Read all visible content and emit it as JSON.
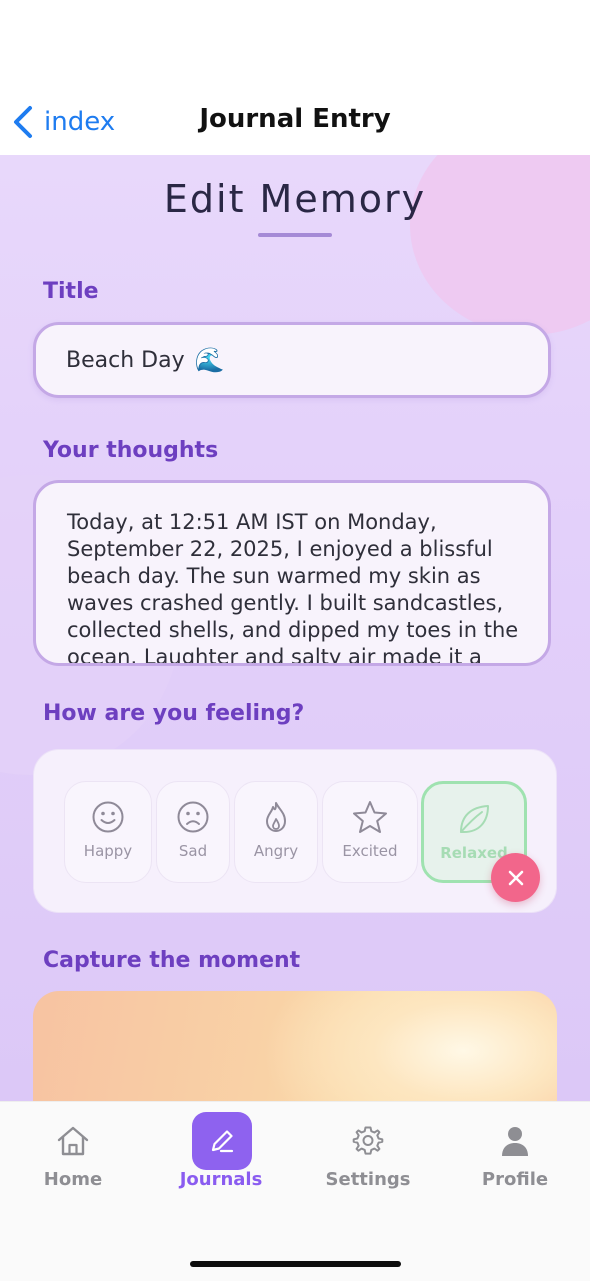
{
  "nav": {
    "back_label": "index",
    "title": "Journal Entry"
  },
  "page": {
    "heading": "Edit Memory"
  },
  "title_field": {
    "label": "Title",
    "value": "Beach Day",
    "emoji": "🌊"
  },
  "thoughts_field": {
    "label": "Your thoughts",
    "value": "Today, at 12:51 AM IST on Monday, September 22, 2025, I enjoyed a blissful beach day. The sun warmed my skin as waves crashed gently. I built sandcastles, collected shells, and dipped my toes in the ocean. Laughter and salty air made it a"
  },
  "mood": {
    "label": "How are you feeling?",
    "options": [
      {
        "label": "Happy",
        "icon": "smile-icon"
      },
      {
        "label": "Sad",
        "icon": "frown-icon"
      },
      {
        "label": "Angry",
        "icon": "flame-icon"
      },
      {
        "label": "Excited",
        "icon": "star-icon"
      },
      {
        "label": "Relaxed",
        "icon": "leaf-icon"
      }
    ],
    "selected": "Relaxed",
    "selected_color": "#9fe2b0"
  },
  "photo": {
    "label": "Capture the moment",
    "remove_icon": "close-icon"
  },
  "tabs": [
    {
      "label": "Home",
      "icon": "home-icon"
    },
    {
      "label": "Journals",
      "icon": "pencil-icon"
    },
    {
      "label": "Settings",
      "icon": "gear-icon"
    },
    {
      "label": "Profile",
      "icon": "person-icon"
    }
  ],
  "active_tab": "Journals",
  "colors": {
    "accent": "#8e62ef",
    "label_purple": "#6d3fc0",
    "link_blue": "#1e7cf0",
    "remove_pink": "#f2668b"
  }
}
